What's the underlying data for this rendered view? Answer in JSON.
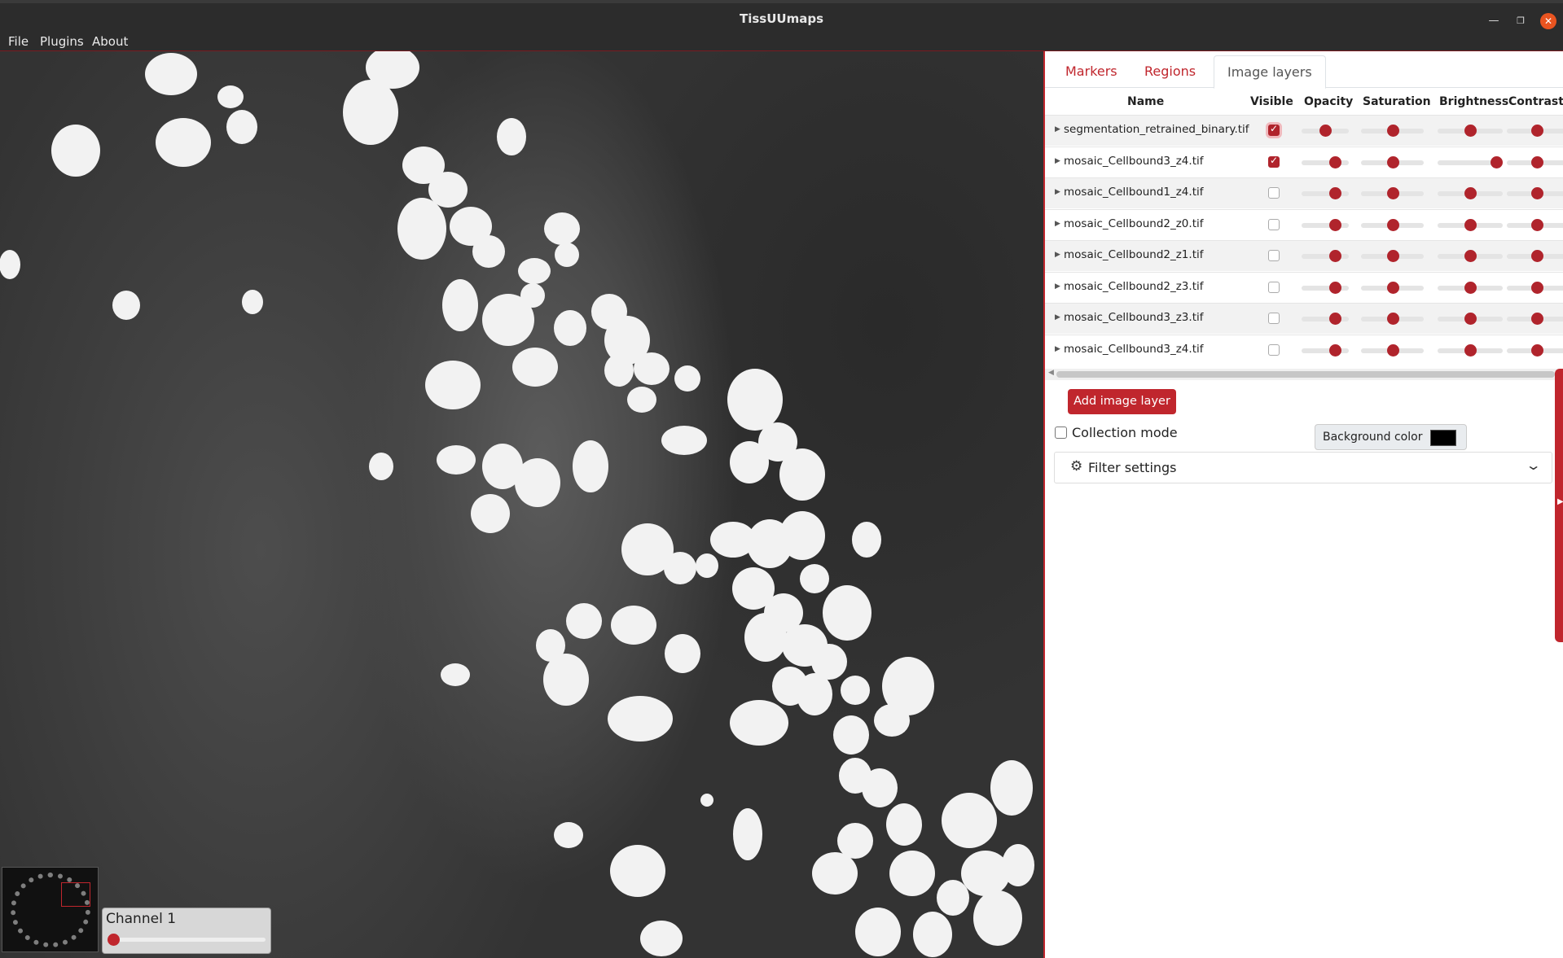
{
  "window": {
    "title": "TissUUmaps"
  },
  "menu": [
    "File",
    "Plugins",
    "About"
  ],
  "tabs": [
    {
      "label": "Markers",
      "active": false
    },
    {
      "label": "Regions",
      "active": false
    },
    {
      "label": "Image layers",
      "active": true
    }
  ],
  "columns": [
    "Name",
    "Visible",
    "Opacity",
    "Saturation",
    "Brightness",
    "Contrast"
  ],
  "layers": [
    {
      "name": "segmentation_retrained_binary.tif",
      "visible": true,
      "opacity": 0.5,
      "saturation": 0.5,
      "brightness": 0.5,
      "contrast": 0.5
    },
    {
      "name": "mosaic_Cellbound3_z4.tif",
      "visible": true,
      "opacity": 0.7,
      "saturation": 0.5,
      "brightness": 0.9,
      "contrast": 0.5
    },
    {
      "name": "mosaic_Cellbound1_z4.tif",
      "visible": false,
      "opacity": 0.7,
      "saturation": 0.5,
      "brightness": 0.5,
      "contrast": 0.5
    },
    {
      "name": "mosaic_Cellbound2_z0.tif",
      "visible": false,
      "opacity": 0.7,
      "saturation": 0.5,
      "brightness": 0.5,
      "contrast": 0.5
    },
    {
      "name": "mosaic_Cellbound2_z1.tif",
      "visible": false,
      "opacity": 0.7,
      "saturation": 0.5,
      "brightness": 0.5,
      "contrast": 0.5
    },
    {
      "name": "mosaic_Cellbound2_z3.tif",
      "visible": false,
      "opacity": 0.7,
      "saturation": 0.5,
      "brightness": 0.5,
      "contrast": 0.5
    },
    {
      "name": "mosaic_Cellbound3_z3.tif",
      "visible": false,
      "opacity": 0.7,
      "saturation": 0.5,
      "brightness": 0.5,
      "contrast": 0.5
    },
    {
      "name": "mosaic_Cellbound3_z4.tif",
      "visible": false,
      "opacity": 0.7,
      "saturation": 0.5,
      "brightness": 0.5,
      "contrast": 0.5
    }
  ],
  "buttons": {
    "add_layer": "Add image layer"
  },
  "collection_mode": {
    "label": "Collection mode",
    "checked": false
  },
  "background_color": {
    "label": "Background color",
    "value": "#000000"
  },
  "filter_settings": {
    "label": "Filter settings",
    "icon": "gear-icon"
  },
  "channel": {
    "label": "Channel 1",
    "value": 0
  },
  "colors": {
    "accent": "#c0262d",
    "titlebar": "#2c2c2c",
    "close": "#e95420"
  }
}
